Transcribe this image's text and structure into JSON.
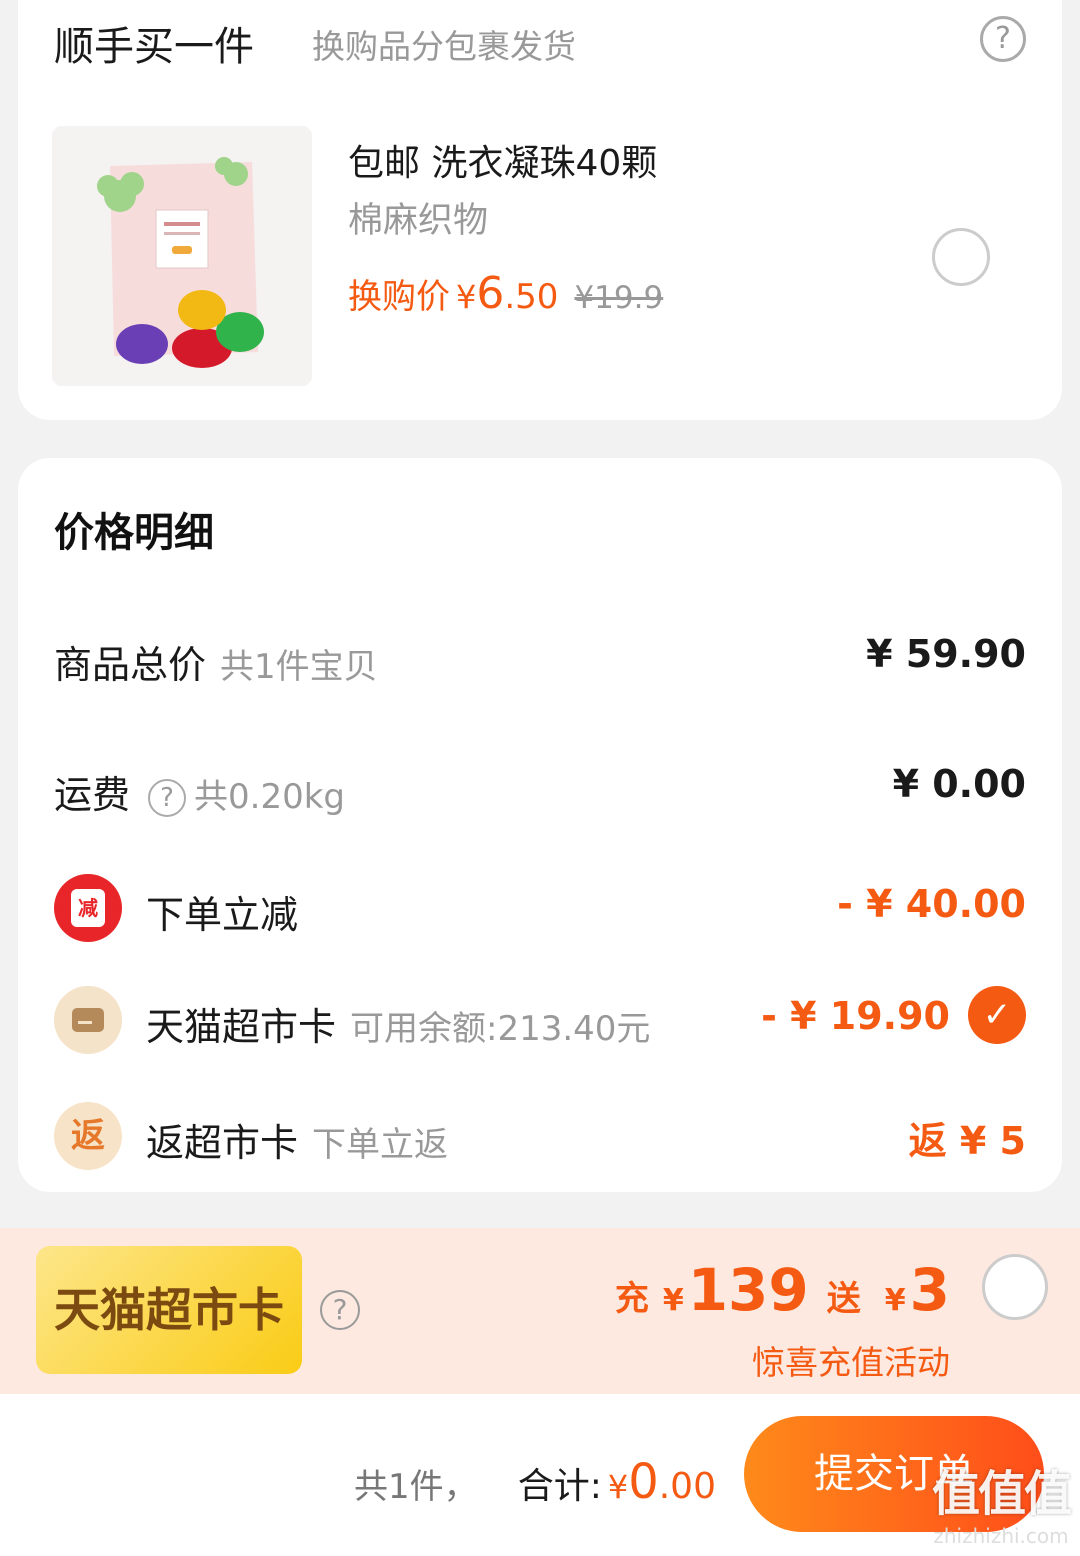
{
  "addon": {
    "title": "顺手买一件",
    "subtitle": "换购品分包裹发货",
    "help": "?",
    "product": {
      "name": "包邮 洗衣凝珠40颗",
      "category": "棉麻织物",
      "price_label": "换购价",
      "currency": "¥",
      "price_int": "6",
      "price_dec": ".50",
      "original_price": "¥19.9",
      "selected": false
    }
  },
  "price_detail": {
    "title": "价格明细",
    "rows": [
      {
        "label": "商品总价",
        "sub": "共1件宝贝",
        "value": "¥ 59.90"
      },
      {
        "label": "运费",
        "help": "?",
        "sub": "共0.20kg",
        "value": "¥ 0.00"
      },
      {
        "label": "下单立减",
        "icon_text": "减",
        "value": "- ¥ 40.00"
      },
      {
        "label": "天猫超市卡",
        "sub": "可用余额:213.40元",
        "value": "- ¥ 19.90",
        "checked": true
      },
      {
        "label": "返超市卡",
        "icon_text": "返",
        "sub": "下单立返",
        "value": "返 ¥ 5"
      }
    ]
  },
  "promo": {
    "badge": "天猫超市卡",
    "help": "?",
    "charge_word": "充",
    "currency": "¥",
    "charge_amount": "139",
    "gift_word": "送",
    "gift_amount": "3",
    "subtitle": "惊喜充值活动",
    "selected": false
  },
  "footer": {
    "count": "共1件，",
    "total_label": "合计:",
    "currency": "¥",
    "total_int": "0",
    "total_dec": ".00",
    "submit": "提交订单"
  },
  "watermark": {
    "text": "值值值",
    "site": "zhizhizhi.com"
  },
  "colors": {
    "accent": "#f55a12",
    "badge_gold": "#facc15",
    "promo_bg": "#fde9e0",
    "discount_red": "#e8262a"
  }
}
